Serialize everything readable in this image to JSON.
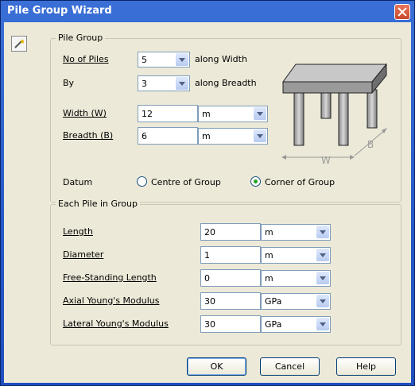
{
  "window": {
    "title": "Pile Group Wizard"
  },
  "pile_group": {
    "legend": "Pile Group",
    "no_of_piles_label": "No of Piles",
    "no_of_piles_value": "5",
    "along_width": "along Width",
    "by_label": "By",
    "by_value": "3",
    "along_breadth": "along Breadth",
    "width_label": "Width (W)",
    "width_value": "12",
    "width_unit": "m",
    "breadth_label": "Breadth (B)",
    "breadth_value": "6",
    "breadth_unit": "m",
    "datum_label": "Datum",
    "datum_options": [
      "Centre of Group",
      "Corner of Group"
    ],
    "datum_selected": "Corner of Group",
    "diagram_labels": {
      "w": "W",
      "b": "B"
    }
  },
  "each_pile": {
    "legend": "Each Pile in Group",
    "rows": [
      {
        "label": "Length",
        "value": "20",
        "unit": "m"
      },
      {
        "label": "Diameter",
        "value": "1",
        "unit": "m"
      },
      {
        "label": "Free-Standing Length",
        "value": "0",
        "unit": "m"
      },
      {
        "label": "Axial Young's Modulus",
        "value": "30",
        "unit": "GPa"
      },
      {
        "label": "Lateral Young's Modulus",
        "value": "30",
        "unit": "GPa"
      }
    ]
  },
  "buttons": {
    "ok": "OK",
    "cancel": "Cancel",
    "help": "Help"
  },
  "icons": {
    "close": "close-icon",
    "wizard": "wand-icon",
    "dropdown": "chevron-down-icon"
  }
}
